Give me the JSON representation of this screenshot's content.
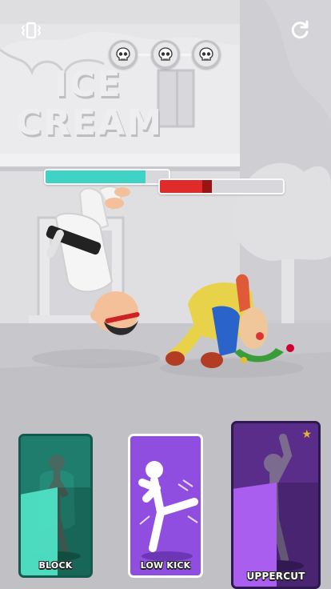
{
  "game": {
    "building_sign_line1": "ICE",
    "building_sign_line2": "CREAM"
  },
  "hud": {
    "vibration_icon": "vibration-icon",
    "restart_icon": "restart-icon",
    "rounds": [
      "skull-icon",
      "skull-icon",
      "skull-icon"
    ],
    "player_health": 0.81,
    "enemy_health": 0.42,
    "player_health_color": "#3fd3c6",
    "enemy_health_color": "#e12a2a"
  },
  "cards": [
    {
      "label": "BLOCK",
      "state": "cooldown",
      "cooldown_remaining": 0.5,
      "color": "#1e7d6c"
    },
    {
      "label": "LOW KICK",
      "state": "ready",
      "color": "#8f4ee0"
    },
    {
      "label": "UPPERCUT",
      "state": "cooldown",
      "cooldown_remaining": 0.5,
      "color": "#5a2d8a",
      "starred": true
    }
  ]
}
